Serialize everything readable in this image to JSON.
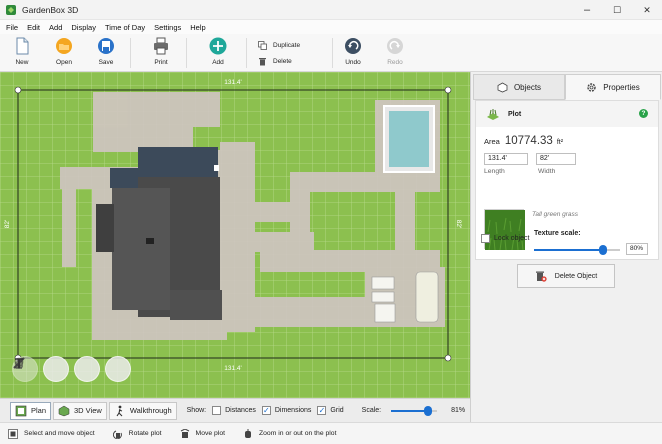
{
  "window": {
    "title": "GardenBox 3D",
    "controls": {
      "minimize": "–",
      "maximize": "☐",
      "close": "✕"
    }
  },
  "menu": [
    "File",
    "Edit",
    "Add",
    "Display",
    "Time of Day",
    "Settings",
    "Help"
  ],
  "toolbar": {
    "new_label": "New",
    "open_label": "Open",
    "save_label": "Save",
    "print_label": "Print",
    "add_label": "Add",
    "duplicate_label": "Duplicate",
    "delete_label": "Delete",
    "undo_label": "Undo",
    "redo_label": "Redo"
  },
  "canvas": {
    "dim_top": "131.4'",
    "dim_bottom": "131.4'",
    "dim_left": "82'",
    "dim_right": "82'",
    "floating_tools": [
      "plant-icon",
      "hand-icon",
      "ruler-icon",
      "text-icon"
    ]
  },
  "viewbar": {
    "plan_label": "Plan",
    "view3d_label": "3D View",
    "walkthrough_label": "Walkthrough",
    "show_label": "Show:",
    "distances_label": "Distances",
    "distances_checked": false,
    "dimensions_label": "Dimensions",
    "dimensions_checked": true,
    "grid_label": "Grid",
    "grid_checked": true,
    "scale_label": "Scale:",
    "scale_value": "81%",
    "scale_fraction": 0.81
  },
  "status": {
    "select_hint": "Select and move object",
    "rotate_hint": "Rotate plot",
    "move_hint": "Move plot",
    "zoom_hint": "Zoom in or out on the plot"
  },
  "panel": {
    "tab_objects": "Objects",
    "tab_properties": "Properties",
    "object_name": "Plot",
    "area_label": "Area",
    "area_value": "10774.33",
    "area_unit": "ft²",
    "length_value": "131.4'",
    "length_label": "Length",
    "width_value": "82'",
    "width_label": "Width",
    "texture_name": "Tall green grass",
    "texture_scale_label": "Texture scale:",
    "texture_scale_value": "80%",
    "texture_scale_fraction": 0.8,
    "lock_label": "Lock object",
    "delete_label": "Delete Object"
  },
  "colors": {
    "grass": "#8cc04f",
    "path": "#cfc5c0",
    "roof": "#4a4a4a",
    "pool": "#8fc9cc",
    "accent": "#1b6fd1"
  }
}
